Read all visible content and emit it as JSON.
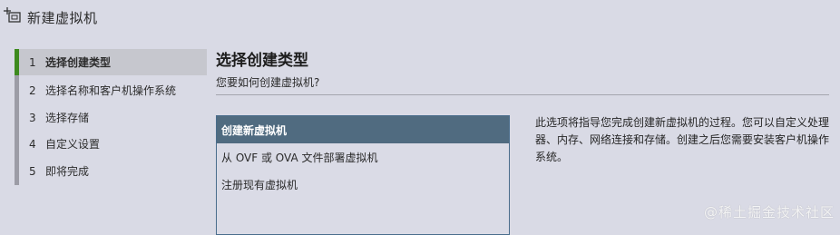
{
  "window": {
    "title": "新建虚拟机",
    "icon": "new-vm-icon"
  },
  "steps": [
    {
      "num": "1",
      "label": "选择创建类型",
      "active": true
    },
    {
      "num": "2",
      "label": "选择名称和客户机操作系统",
      "active": false
    },
    {
      "num": "3",
      "label": "选择存储",
      "active": false
    },
    {
      "num": "4",
      "label": "自定义设置",
      "active": false
    },
    {
      "num": "5",
      "label": "即将完成",
      "active": false
    }
  ],
  "main": {
    "heading": "选择创建类型",
    "subheading": "您要如何创建虚拟机?",
    "options": [
      {
        "label": "创建新虚拟机",
        "selected": true
      },
      {
        "label": "从 OVF 或 OVA 文件部署虚拟机",
        "selected": false
      },
      {
        "label": "注册现有虚拟机",
        "selected": false
      }
    ],
    "description": "此选项将指导您完成创建新虚拟机的过程。您可以自定义处理器、内存、网络连接和存储。创建之后您需要安装客户机操作系统。"
  },
  "watermark": "@稀土掘金技术社区",
  "colors": {
    "background": "#d9dae5",
    "active_step_accent": "#3d8a1e",
    "selected_option": "#506b80",
    "listbox_border": "#4a6d8c"
  }
}
